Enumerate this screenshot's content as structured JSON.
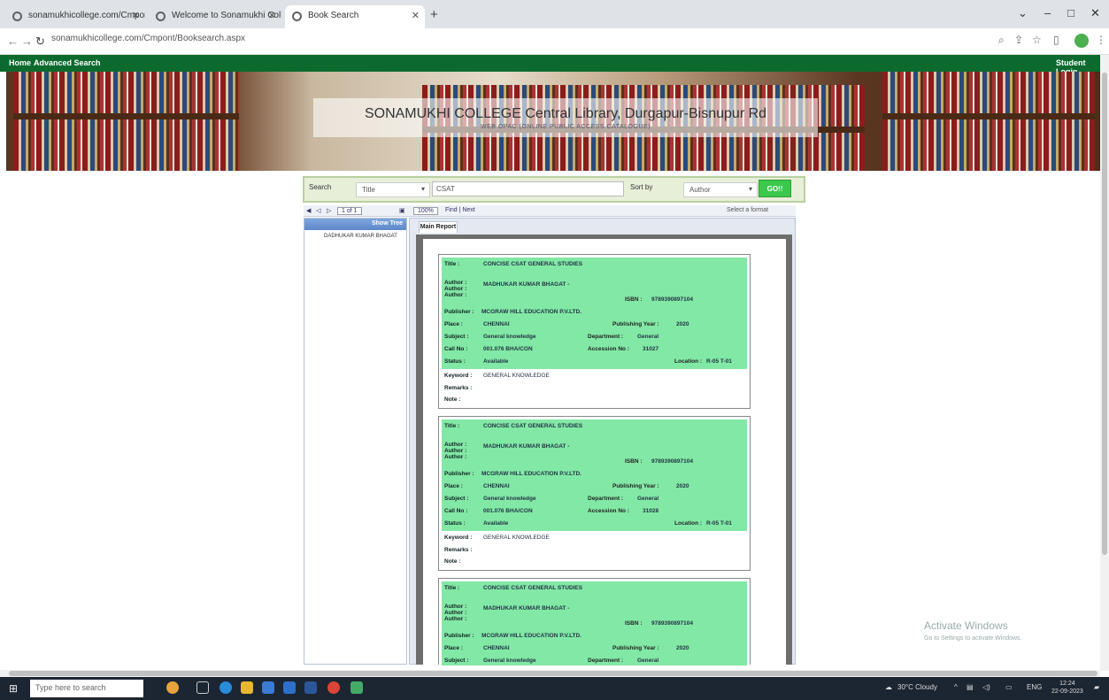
{
  "browser": {
    "tabs": [
      {
        "title": "sonamukhicollege.com/Cmpont/"
      },
      {
        "title": "Welcome to Sonamukhi College"
      },
      {
        "title": "Book Search"
      }
    ],
    "url": "sonamukhicollege.com/Cmpont/Booksearch.aspx"
  },
  "site_nav": {
    "home": "Home",
    "advanced_search": "Advanced Search",
    "student_login": "Student Login"
  },
  "banner": {
    "title": "SONAMUKHI COLLEGE Central Library, Durgapur-Bisnupur Rd",
    "subtitle": "WEB OPAC (ONLINE PUBLIC ACCESS CATALOGUE)"
  },
  "search": {
    "search_label": "Search",
    "field_value": "Title",
    "query": "CSAT",
    "sort_label": "Sort by",
    "sort_value": "Author",
    "go_label": "GO!!"
  },
  "viewer": {
    "toolbar": {
      "page_field": "1 of 1",
      "zoom": "100%",
      "find": "Find | Next",
      "export": "Select a format"
    },
    "tree_header": "Show Tree",
    "tree_node": "DADHUKAR KUMAR BHAGAT",
    "tab_label": "Main Report"
  },
  "records": [
    {
      "title": "CONCISE CSAT GENERAL STUDIES",
      "author": "MADHUKAR KUMAR BHAGAT -",
      "isbn": "9789390897104",
      "publisher": "MCGRAW HILL EDUCATION P.V.LTD.",
      "place": "CHENNAI",
      "year": "2020",
      "subject": "General knowledge",
      "department": "General",
      "call_no": "001.076 BHA/CON",
      "accession": "31027",
      "status": "Available",
      "location": "R-05 T-01",
      "keyword": "GENERAL KNOWLEDGE"
    },
    {
      "title": "CONCISE CSAT GENERAL STUDIES",
      "author": "MADHUKAR KUMAR BHAGAT -",
      "isbn": "9789390897104",
      "publisher": "MCGRAW HILL EDUCATION P.V.LTD.",
      "place": "CHENNAI",
      "year": "2020",
      "subject": "General knowledge",
      "department": "General",
      "call_no": "001.076 BHA/CON",
      "accession": "31028",
      "status": "Available",
      "location": "R-05 T-01",
      "keyword": "GENERAL KNOWLEDGE"
    },
    {
      "title": "CONCISE CSAT GENERAL STUDIES",
      "author": "MADHUKAR KUMAR BHAGAT -",
      "isbn": "9789390897104",
      "publisher": "MCGRAW HILL EDUCATION P.V.LTD.",
      "place": "CHENNAI",
      "year": "2020",
      "subject": "General knowledge",
      "department": "General",
      "call_no": "",
      "accession": "",
      "status": "",
      "location": "",
      "keyword": ""
    }
  ],
  "labels": {
    "title": "Title :",
    "author": "Author :",
    "isbn": "ISBN :",
    "publisher": "Publisher :",
    "place": "Place :",
    "year": "Publishing Year :",
    "subject": "Subject :",
    "department": "Department :",
    "call_no": "Call No :",
    "accession": "Accession No :",
    "status": "Status :",
    "location": "Location :",
    "keyword": "Keyword :",
    "remarks": "Remarks :",
    "note": "Note :"
  },
  "watermark": {
    "line1": "Activate Windows",
    "line2": "Go to Settings to activate Windows."
  },
  "taskbar": {
    "search_placeholder": "Type here to search",
    "weather": "30°C Cloudy",
    "lang": "ENG",
    "time": "12:24",
    "date": "22-09-2023"
  }
}
